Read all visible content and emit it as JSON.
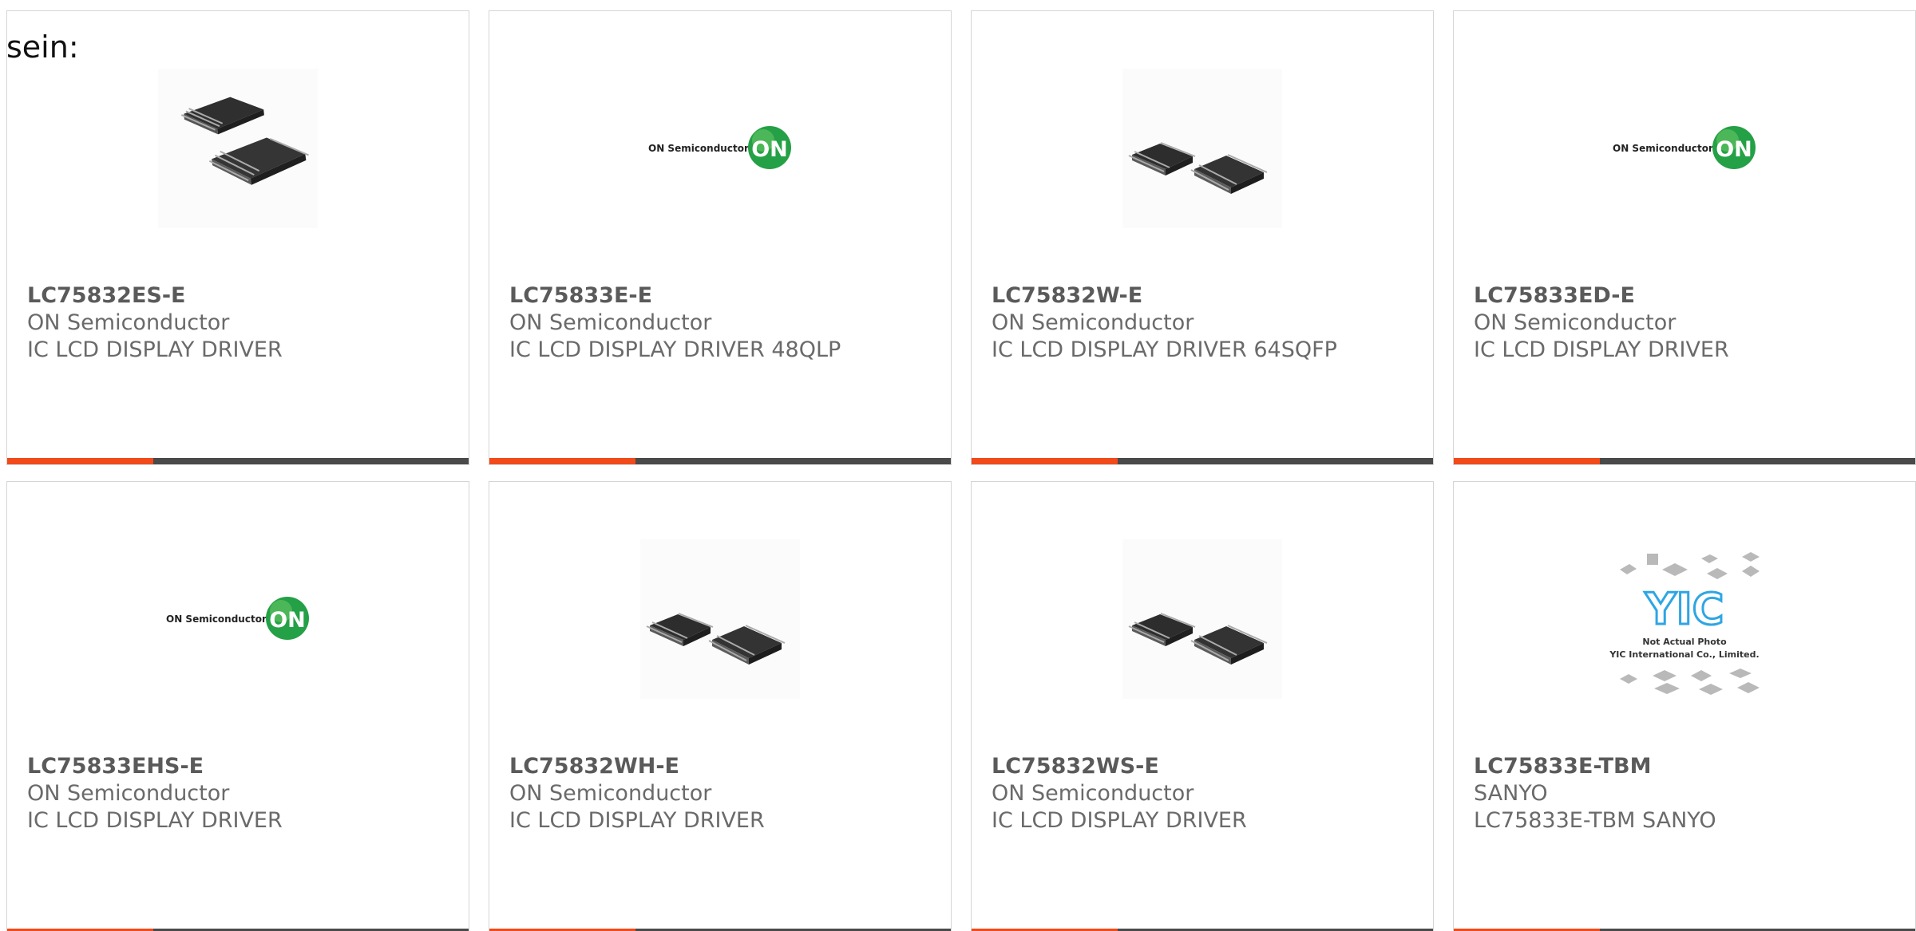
{
  "page": {
    "intro_text": "sein:"
  },
  "colors": {
    "accent": "#f14a1b",
    "bar": "#4a4a4a",
    "border": "#d5d5d5",
    "on_green": "#24a046",
    "yic_blue": "#2ea6e3"
  },
  "products": [
    {
      "part_number": "LC75832ES-E",
      "manufacturer": "ON Semiconductor",
      "description": "IC LCD DISPLAY DRIVER",
      "image_type": "two-qfp-chip-photo"
    },
    {
      "part_number": "LC75833E-E",
      "manufacturer": "ON Semiconductor",
      "description": "IC LCD DISPLAY DRIVER 48QLP",
      "image_type": "on-semiconductor-logo",
      "logo_text": "ON Semiconductor",
      "logo_mark": "ON"
    },
    {
      "part_number": "LC75832W-E",
      "manufacturer": "ON Semiconductor",
      "description": "IC LCD DISPLAY DRIVER 64SQFP",
      "image_type": "two-qfp-chip-photo"
    },
    {
      "part_number": "LC75833ED-E",
      "manufacturer": "ON Semiconductor",
      "description": "IC LCD DISPLAY DRIVER",
      "image_type": "on-semiconductor-logo",
      "logo_text": "ON Semiconductor",
      "logo_mark": "ON"
    },
    {
      "part_number": "LC75833EHS-E",
      "manufacturer": "ON Semiconductor",
      "description": "IC LCD DISPLAY DRIVER",
      "image_type": "on-semiconductor-logo",
      "logo_text": "ON Semiconductor",
      "logo_mark": "ON"
    },
    {
      "part_number": "LC75832WH-E",
      "manufacturer": "ON Semiconductor",
      "description": "IC LCD DISPLAY DRIVER",
      "image_type": "two-qfp-chip-photo"
    },
    {
      "part_number": "LC75832WS-E",
      "manufacturer": "ON Semiconductor",
      "description": "IC LCD DISPLAY DRIVER",
      "image_type": "two-qfp-chip-photo"
    },
    {
      "part_number": "LC75833E-TBM",
      "manufacturer": "SANYO",
      "description": "LC75833E-TBM SANYO",
      "image_type": "yic-placeholder-photo",
      "logo_mark": "YIC",
      "photo_note_line1": "Not Actual Photo",
      "photo_note_line2": "YIC International Co., Limited."
    }
  ]
}
